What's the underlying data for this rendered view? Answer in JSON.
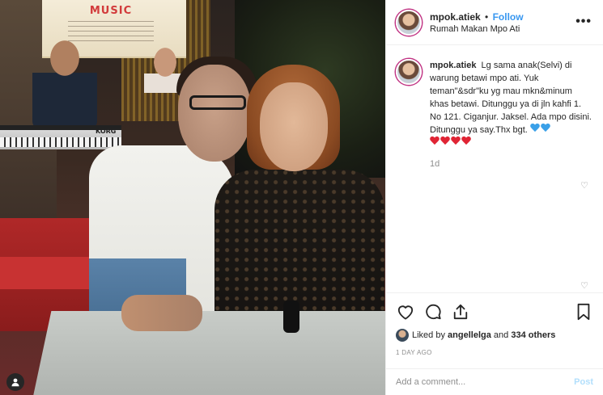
{
  "post": {
    "username": "mpok.atiek",
    "follow_label": "Follow",
    "separator": "•",
    "location": "Rumah Makan Mpo Ati",
    "more_icon": "more-horizontal-icon",
    "photo": {
      "poster_text": "MUSIC",
      "keyboard_label": "KORG"
    }
  },
  "caption": {
    "username": "mpok.atiek",
    "text": "Lg sama anak(Selvi) di warung betawi mpo ati. Yuk teman\"&sdr\"ku yg mau mkn&minum khas betawi. Ditunggu ya di jln kahfi 1. No 121. Ciganjur. Jaksel. Ada mpo disini. Ditunggu ya say.Thx bgt.",
    "time_ago": "1d",
    "emoji_colors": {
      "blue": "#3aa0e8",
      "red": "#e02434"
    }
  },
  "actions": {
    "like_icon": "heart-outline-icon",
    "comment_icon": "comment-icon",
    "share_icon": "share-icon",
    "save_icon": "bookmark-icon"
  },
  "likes": {
    "prefix": "Liked by",
    "user": "angellelga",
    "connector": "and",
    "others": "334 others"
  },
  "date": "1 DAY AGO",
  "comment_box": {
    "placeholder": "Add a comment...",
    "post_label": "Post"
  },
  "colors": {
    "link_blue": "#3897f0",
    "post_disabled": "#b2dffc",
    "muted": "#8e8e8e",
    "text": "#262626"
  }
}
